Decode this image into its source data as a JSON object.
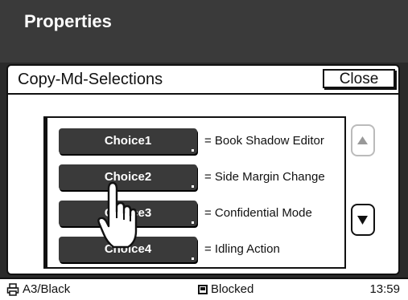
{
  "window": {
    "title": "Properties"
  },
  "dialog": {
    "title": "Copy-Md-Selections",
    "close_label": "Close"
  },
  "choices": [
    {
      "label": "Choice1",
      "description": "= Book Shadow Editor"
    },
    {
      "label": "Choice2",
      "description": "= Side Margin Change"
    },
    {
      "label": "Choice3",
      "description": "= Confidential Mode"
    },
    {
      "label": "Choice4",
      "description": "= Idling Action"
    }
  ],
  "status": {
    "left_text": "A3/Black",
    "middle_text": "Blocked",
    "time": "13:59"
  },
  "icons": {
    "scroll_up": "triangle-up-icon",
    "scroll_down": "triangle-down-icon",
    "pointer": "hand-pointer-icon",
    "printer": "printer-icon",
    "blocked": "stop-square-icon"
  },
  "colors": {
    "title_bg": "#3a3a3a",
    "button_bg": "#3a3a3a",
    "text": "#111111"
  }
}
